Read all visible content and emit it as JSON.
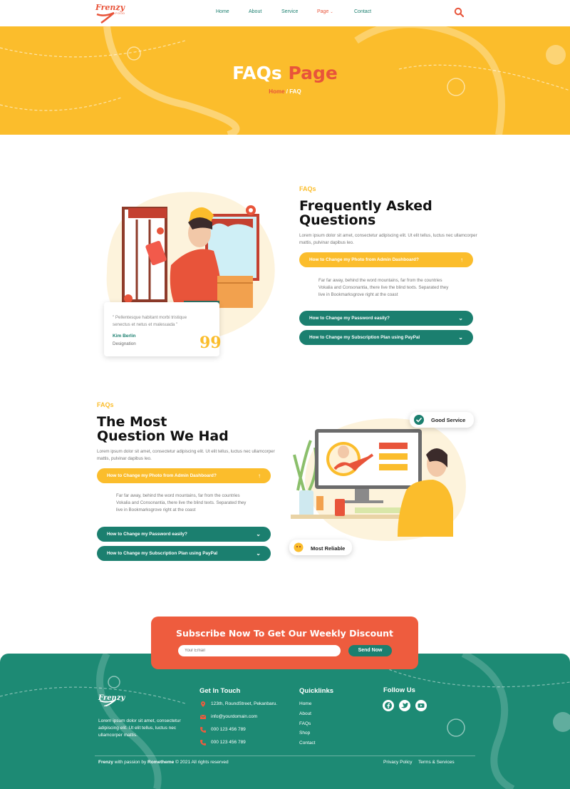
{
  "brand": {
    "name": "Frenzy",
    "sub": "FOOD"
  },
  "nav": {
    "items": [
      "Home",
      "About",
      "Service",
      "Page",
      "Contact"
    ],
    "active": "Page"
  },
  "hero": {
    "title_white": "FAQs",
    "title_accent": "Page",
    "crumb_home": "Home",
    "crumb_sep": "/",
    "crumb_current": "FAQ"
  },
  "faq1": {
    "eyebrow": "FAQs",
    "title_line1": "Frequently Asked",
    "title_line2": "Questions",
    "lead": "Lorem ipsum dolor sit amet, consectetur adipiscing elit. Ut elit tellus, luctus nec ullamcorper mattis, pulvinar dapibus leo.",
    "open_question": "How to Change my Photo from Admin Dashboard?",
    "answer": "Far far away, behind the word mountains, far from the countries Vokalia and Consonantia, there live the blind texts. Separated they live in Bookmarksgrove right at the coast",
    "q2": "How to Change my Password easily?",
    "q3": "How to Change my Subscription Plan using PayPal"
  },
  "testimonial": {
    "quote": "\" Pellentesque habitant morbi tristique senectus et netus et malesuada \"",
    "name": "Kim Berlin",
    "designation": "Designation",
    "mark": "99"
  },
  "faq2": {
    "eyebrow": "FAQs",
    "title_line1": "The Most",
    "title_line2": "Question We Had",
    "lead": "Lorem ipsum dolor sit amet, consectetur adipiscing elit. Ut elit tellus, luctus nec ullamcorper mattis, pulvinar dapibus leo.",
    "open_question": "How to Change my Photo from Admin Dashboard?",
    "answer": "Far far away, behind the word mountains, far from the countries Vokalia and Consonantia, there live the blind texts. Separated they live in Bookmarksgrove right at the coast",
    "q2": "How to Change my Password easily?",
    "q3": "How to Change my Subscription Plan using PayPal"
  },
  "badges": {
    "good": "Good Service",
    "reliable": "Most Reliable"
  },
  "subscribe": {
    "title": "Subscribe Now To Get Our Weekly Discount",
    "placeholder": "Your Email",
    "button": "Send Now"
  },
  "footer": {
    "about": "Lorem ipsum dolor sit amet, consectetur adipiscing elit. Ut elit tellus, luctus nec ullamcorper mattis.",
    "touch_title": "Get In Touch",
    "address": "123th, RoundStreet, Pekanbaru.",
    "email": "info@yourdomain.com",
    "phone1": "000 123 456 789",
    "phone2": "000 123 456 789",
    "quick_title": "Quicklinks",
    "links": [
      "Home",
      "About",
      "FAQs",
      "Shop",
      "Contact"
    ],
    "follow_title": "Follow Us",
    "copy_brand": "Frenzy",
    "copy_mid": " with passion by ",
    "copy_author": "Rometheme",
    "copy_end": " © 2021 All rights reserved",
    "privacy": "Privacy Policy",
    "terms": "Terms & Services"
  },
  "colors": {
    "yellow": "#fbbd2c",
    "teal": "#1b7f6f",
    "orange": "#e8543a"
  }
}
